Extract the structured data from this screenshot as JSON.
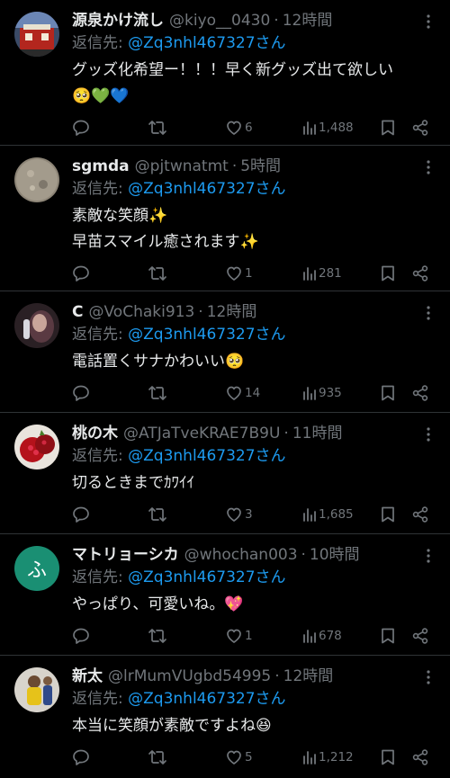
{
  "colors": {
    "background": "#000000",
    "text": "#e7e9ea",
    "muted": "#71767b",
    "link": "#1d9bf0",
    "divider": "#2f3336"
  },
  "replies": [
    {
      "name": "源泉かけ流し",
      "handle": "@kiyo__0430",
      "dot": "·",
      "time": "12時間",
      "reply_prefix": "返信先: ",
      "mention": "@Zq3nhl467327さん",
      "text_lines": [
        "グッズ化希望ー！！！早く新グッズ出て欲しい",
        "🥺💚💙"
      ],
      "reply_count": "",
      "retweet_count": "",
      "like_count": "6",
      "view_count": "1,488",
      "avatar": "photo-avatar-red"
    },
    {
      "name": "sgmda",
      "handle": "@pjtwnatmt",
      "dot": "·",
      "time": "5時間",
      "reply_prefix": "返信先: ",
      "mention": "@Zq3nhl467327さん",
      "text_lines": [
        "素敵な笑顔✨",
        "早苗スマイル癒されます✨"
      ],
      "reply_count": "",
      "retweet_count": "",
      "like_count": "1",
      "view_count": "281",
      "avatar": "photo-avatar-gray"
    },
    {
      "name": "C",
      "handle": "@VoChaki913",
      "dot": "·",
      "time": "12時間",
      "reply_prefix": "返信先: ",
      "mention": "@Zq3nhl467327さん",
      "text_lines": [
        "電話置くサナかわいい🥺"
      ],
      "reply_count": "",
      "retweet_count": "",
      "like_count": "14",
      "view_count": "935",
      "avatar": "photo-avatar-dark"
    },
    {
      "name": "桃の木",
      "handle": "@ATJaTveKRAE7B9U",
      "dot": "·",
      "time": "11時間",
      "reply_prefix": "返信先: ",
      "mention": "@Zq3nhl467327さん",
      "text_lines": [
        "切るときまでｶﾜｲｲ"
      ],
      "reply_count": "",
      "retweet_count": "",
      "like_count": "3",
      "view_count": "1,685",
      "avatar": "photo-avatar-pomegranate"
    },
    {
      "name": "マトリョーシカ",
      "handle": "@whochan003",
      "dot": "·",
      "time": "10時間",
      "reply_prefix": "返信先: ",
      "mention": "@Zq3nhl467327さん",
      "text_lines": [
        "やっぱり、可愛いね。💖"
      ],
      "reply_count": "",
      "retweet_count": "",
      "like_count": "1",
      "view_count": "678",
      "avatar": "letter-avatar",
      "avatar_letter": "ふ",
      "avatar_color": "#1a8f73"
    },
    {
      "name": "新太",
      "handle": "@lrMumVUgbd54995",
      "dot": "·",
      "time": "12時間",
      "reply_prefix": "返信先: ",
      "mention": "@Zq3nhl467327さん",
      "text_lines": [
        "本当に笑顔が素敵ですよね😆"
      ],
      "reply_count": "",
      "retweet_count": "",
      "like_count": "5",
      "view_count": "1,212",
      "avatar": "photo-avatar-child"
    }
  ]
}
